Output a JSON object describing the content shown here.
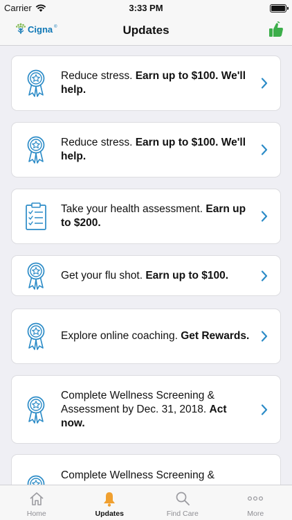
{
  "status_bar": {
    "carrier": "Carrier",
    "time": "3:33 PM"
  },
  "nav": {
    "title": "Updates",
    "logo_text": "Cigna",
    "logo_mark": "®"
  },
  "colors": {
    "accent": "#2b8bc7",
    "logo_green": "#7ab648",
    "thumb_green": "#3cae4a",
    "tab_active": "#f0a030"
  },
  "cards": [
    {
      "icon": "award-ribbon-icon",
      "plain": "Reduce stress. ",
      "bold": "Earn up to $100. We'll help."
    },
    {
      "icon": "award-ribbon-icon",
      "plain": "Reduce stress. ",
      "bold": "Earn up to $100. We'll help."
    },
    {
      "icon": "clipboard-checklist-icon",
      "plain": "Take your health assessment. ",
      "bold": "Earn up to $200."
    },
    {
      "icon": "award-ribbon-icon",
      "plain": "Get your flu shot. ",
      "bold": "Earn up to $100."
    },
    {
      "icon": "award-ribbon-icon",
      "plain": "Explore online coaching. ",
      "bold": "Get Rewards."
    },
    {
      "icon": "award-ribbon-icon",
      "plain": "Complete Wellness Screening & Assessment by Dec. 31, 2018. ",
      "bold": "Act now."
    },
    {
      "icon": "award-ribbon-icon",
      "plain": "Complete Wellness Screening &",
      "bold": ""
    }
  ],
  "tabs": [
    {
      "label": "Home",
      "icon": "home-icon"
    },
    {
      "label": "Updates",
      "icon": "bell-icon"
    },
    {
      "label": "Find Care",
      "icon": "search-icon"
    },
    {
      "label": "More",
      "icon": "more-dots-icon"
    }
  ]
}
